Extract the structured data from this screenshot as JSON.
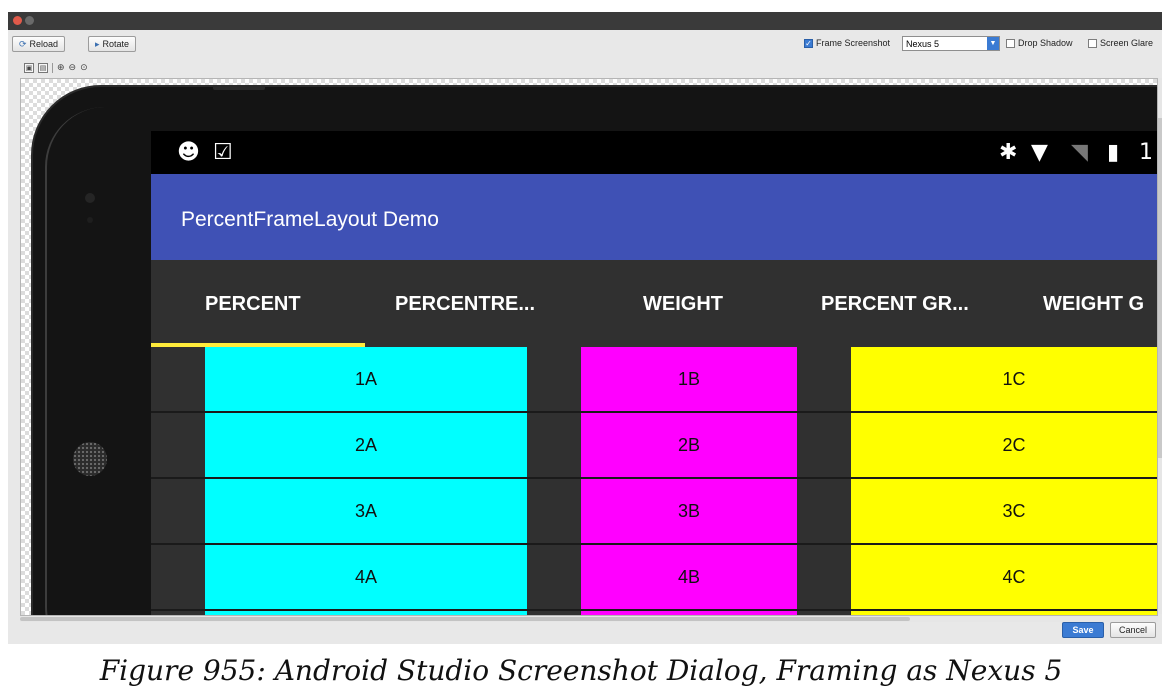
{
  "toolbar": {
    "reload_label": "Reload",
    "rotate_label": "Rotate",
    "frame_screenshot_label": "Frame Screenshot",
    "frame_screenshot_checked": true,
    "device_select_value": "Nexus 5",
    "drop_shadow_label": "Drop Shadow",
    "drop_shadow_checked": false,
    "screen_glare_label": "Screen Glare",
    "screen_glare_checked": false
  },
  "app": {
    "title": "PercentFrameLayout Demo",
    "tabs": [
      {
        "label": "PERCENT",
        "selected": true
      },
      {
        "label": "PERCENTRE..."
      },
      {
        "label": "WEIGHT"
      },
      {
        "label": "PERCENT GR..."
      },
      {
        "label": "WEIGHT G"
      }
    ],
    "status_time_partial": "1",
    "rows": [
      {
        "a": "1A",
        "b": "1B",
        "c": "1C"
      },
      {
        "a": "2A",
        "b": "2B",
        "c": "2C"
      },
      {
        "a": "3A",
        "b": "3B",
        "c": "3C"
      },
      {
        "a": "4A",
        "b": "4B",
        "c": "4C"
      }
    ]
  },
  "footer": {
    "save_label": "Save",
    "cancel_label": "Cancel"
  },
  "caption": "Figure 955: Android Studio Screenshot Dialog, Framing as Nexus 5",
  "colors": {
    "app_bar": "#3f51b5",
    "tab_indicator": "#ffeb3b",
    "cell_a": "#00ffff",
    "cell_b": "#ff00ff",
    "cell_c": "#ffff00"
  }
}
